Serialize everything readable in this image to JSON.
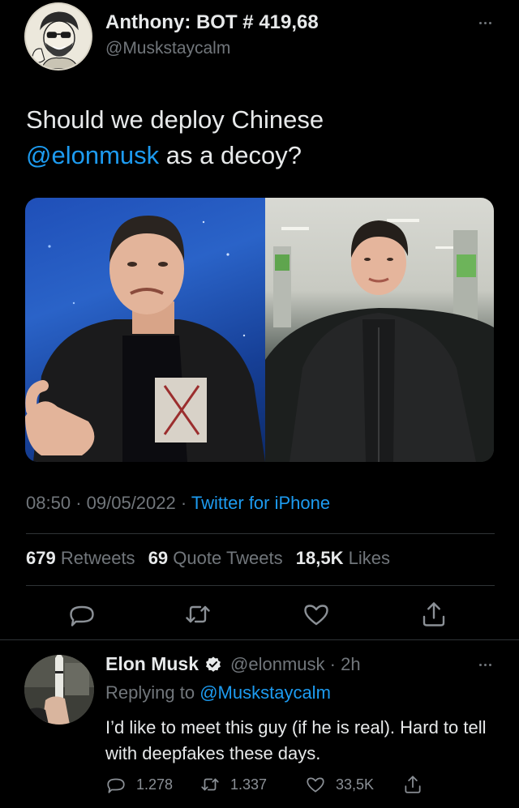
{
  "main_tweet": {
    "author_name": "Anthony: BOT # 419,68",
    "author_handle": "@Muskstaycalm",
    "text_before": "Should we deploy Chinese",
    "text_mention": "@elonmusk",
    "text_after": " as a decoy?",
    "time": "08:50",
    "date": "09/05/2022",
    "source": "Twitter for iPhone",
    "stats": {
      "retweets_count": "679",
      "retweets_label": "Retweets",
      "quotes_count": "69",
      "quotes_label": "Quote Tweets",
      "likes_count": "18,5K",
      "likes_label": "Likes"
    }
  },
  "reply": {
    "author_name": "Elon Musk",
    "handle": "@elonmusk",
    "time_ago": "2h",
    "replying_label": "Replying to",
    "replying_to": "@Muskstaycalm",
    "text": "I’d like to meet this guy (if he is real). Hard to tell with deepfakes these days.",
    "reply_count": "1.278",
    "retweet_count": "1.337",
    "like_count": "33,5K"
  },
  "icons": {
    "reply": "reply-icon",
    "retweet": "retweet-icon",
    "like": "heart-icon",
    "share": "share-icon",
    "more": "more-icon",
    "verified": "verified-badge-icon"
  },
  "colors": {
    "background": "#000000",
    "text": "#e7e9ea",
    "secondary": "#71767b",
    "link": "#1d9bf0",
    "divider": "#2f3336"
  }
}
